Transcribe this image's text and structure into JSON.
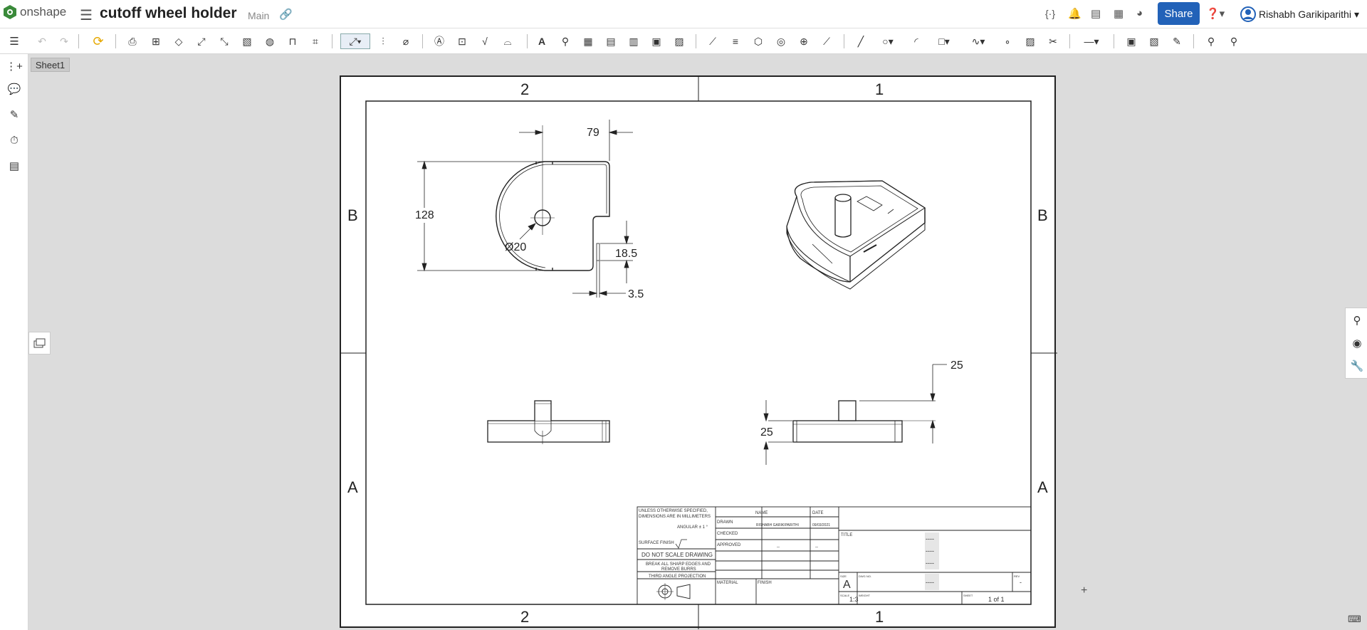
{
  "app": {
    "brand": "onshape",
    "document_title": "cutoff wheel holder",
    "branch": "Main"
  },
  "header": {
    "share_label": "Share",
    "user_name": "Rishabh Garikiparithi"
  },
  "sheet": {
    "tab_label": "Sheet1"
  },
  "drawing": {
    "zones_top": [
      "2",
      "1"
    ],
    "zones_bottom": [
      "2",
      "1"
    ],
    "zones_left": [
      "B",
      "A"
    ],
    "zones_right": [
      "B",
      "A"
    ],
    "dimensions": {
      "width_top": "79",
      "height_left": "128",
      "hole_diameter": "Ø20",
      "slot_height": "18.5",
      "slot_width": "3.5",
      "right_height": "25",
      "right_base": "25"
    },
    "title_block": {
      "notes_line1": "UNLESS OTHERWISE SPECIFIED,",
      "notes_line2": "DIMENSIONS ARE IN MILLIMETERS",
      "angular": "ANGULAR ± 1 °",
      "surface_finish": "SURFACE FINISH",
      "do_not_scale": "DO NOT SCALE DRAWING",
      "break_edges_1": "BREAK ALL SHARP EDGES AND",
      "break_edges_2": "REMOVE BURRS",
      "projection": "THIRD ANGLE PROJECTION",
      "name_header": "NAME",
      "date_header": "DATE",
      "drawn_label": "DRAWN",
      "drawn_name": "RISHABH GARIKIPARITHI",
      "drawn_date": "09/03/2021",
      "checked_label": "CHECKED",
      "approved_label": "APPROVED",
      "approved_name": "--",
      "approved_date": "--",
      "material_label": "MATERIAL",
      "finish_label": "FINISH",
      "title_label": "TITLE",
      "title_value_1": "----",
      "title_value_2": "----",
      "title_value_3": "----",
      "size_label": "SIZE",
      "size_value": "A",
      "dwg_label": "DWG NO.",
      "dwg_value": "----",
      "rev_label": "REV",
      "rev_value": "-",
      "scale_label": "SCALE",
      "scale_value": "1:3",
      "weight_label": "WEIGHT",
      "sheet_label": "SHEET",
      "sheet_value": "1 of 1"
    }
  }
}
